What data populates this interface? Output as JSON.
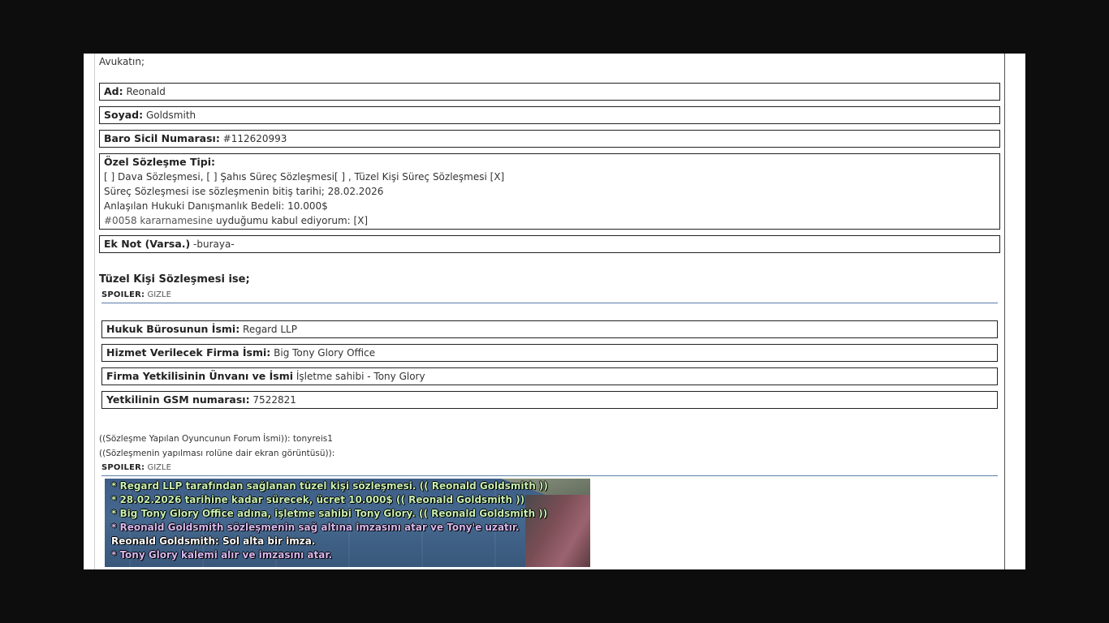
{
  "intro": "Avukatın;",
  "fields": [
    {
      "label": "Ad:",
      "value": "Reonald"
    },
    {
      "label": "Soyad:",
      "value": "Goldsmith"
    },
    {
      "label": "Baro Sicil Numarası:",
      "value": "#112620993"
    }
  ],
  "contract": {
    "label": "Özel Sözleşme Tipi:",
    "lines": [
      "[ ] Dava Sözleşmesi, [ ] Şahıs Süreç Sözleşmesi[ ] , Tüzel Kişi Süreç Sözleşmesi [X]",
      "Süreç Sözleşmesi ise sözleşmenin bitiş tarihi; 28.02.2026",
      "Anlaşılan Hukuki Danışmanlık Bedeli: 10.000$"
    ],
    "decree_link": "#0058 kararnamesine",
    "decree_rest": " uyduğumu kabul ediyorum: [X]"
  },
  "note": {
    "label": "Ek Not (Varsa.)",
    "value": " -buraya-"
  },
  "corporate_heading": "Tüzel Kişi Sözleşmesi ise;",
  "spoiler1": {
    "label": "SPOILER:",
    "toggle": "GIZLE"
  },
  "corporate_fields": [
    {
      "label": "Hukuk Bürosunun İsmi:",
      "value": "Regard LLP"
    },
    {
      "label": "Hizmet Verilecek Firma İsmi:",
      "value": "Big Tony Glory Office"
    },
    {
      "label": "Firma Yetkilisinin Ünvanı ve İsmi",
      "value": "İşletme sahibi - Tony Glory"
    },
    {
      "label": "Yetkilinin GSM numarası:",
      "value": "7522821"
    }
  ],
  "forum_name": "((Sözleşme Yapılan Oyuncunun Forum İsmi)): tonyreis1",
  "screenshot_caption": "((Sözleşmenin yapılması rolüne dair ekran görüntüsü)):",
  "spoiler2": {
    "label": "SPOILER:",
    "toggle": "GIZLE"
  },
  "chat": [
    {
      "text": "* Regard LLP tarafından sağlanan tüzel kişi sözleşmesi. (( Reonald Goldsmith ))",
      "color": "green"
    },
    {
      "text": "* 28.02.2026 tarihine kadar sürecek, ücret 10.000$ (( Reonald Goldsmith ))",
      "color": "green"
    },
    {
      "text": "* Big Tony Glory Office adına, işletme sahibi Tony Glory. (( Reonald Goldsmith ))",
      "color": "green"
    },
    {
      "text": "* Reonald Goldsmith sözleşmenin sağ altına imzasını atar ve Tony'e uzatır.",
      "color": "purple"
    },
    {
      "text": "Reonald Goldsmith: Sol alta bir imza.",
      "color": "white"
    },
    {
      "text": "* Tony Glory kalemi alır ve imzasını atar.",
      "color": "purple"
    }
  ],
  "colors": {
    "background": "#0d0d0d",
    "page": "#ffffff",
    "spoiler_rule": "#5a7ea8",
    "chat_green": "#c8f0b0",
    "chat_purple": "#d8b8f0"
  }
}
